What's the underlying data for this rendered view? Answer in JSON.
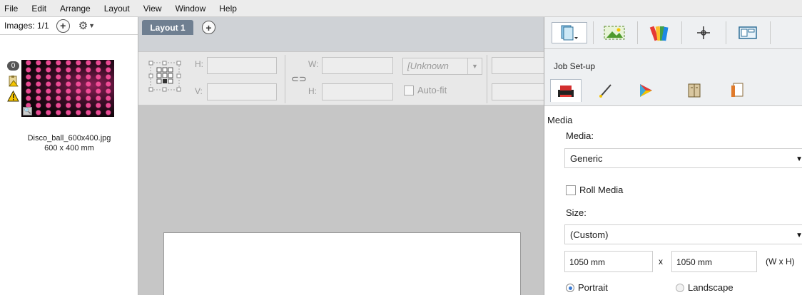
{
  "menu": {
    "items": [
      "File",
      "Edit",
      "Arrange",
      "Layout",
      "View",
      "Window",
      "Help"
    ]
  },
  "images_panel": {
    "header_label": "Images: 1/1",
    "badge_count": "0",
    "file_name": "Disco_ball_600x400.jpg",
    "file_size": "600 x 400 mm"
  },
  "tabs": {
    "active_tab": "Layout 1"
  },
  "toolbar": {
    "h_label": "H:",
    "v_label": "V:",
    "w_label": "W:",
    "h2_label": "H:",
    "unit_select_value": "[Unknown",
    "autofit_label": "Auto-fit"
  },
  "right_panel": {
    "section_title": "Job Set-up",
    "media_heading": "Media",
    "media_label": "Media:",
    "media_value": "Generic",
    "roll_media_label": "Roll Media",
    "size_label": "Size:",
    "size_value": "(Custom)",
    "width_value": "1050 mm",
    "x_label": "x",
    "height_value": "1050 mm",
    "wxh_label": "(W x H)",
    "portrait_label": "Portrait",
    "landscape_label": "Landscape",
    "orientation_selected": "Portrait"
  },
  "icons": {
    "colors": {
      "accent_blue": "#3a7bd5",
      "tab_active": "#6f7f91",
      "warning_yellow": "#f5c400"
    }
  }
}
